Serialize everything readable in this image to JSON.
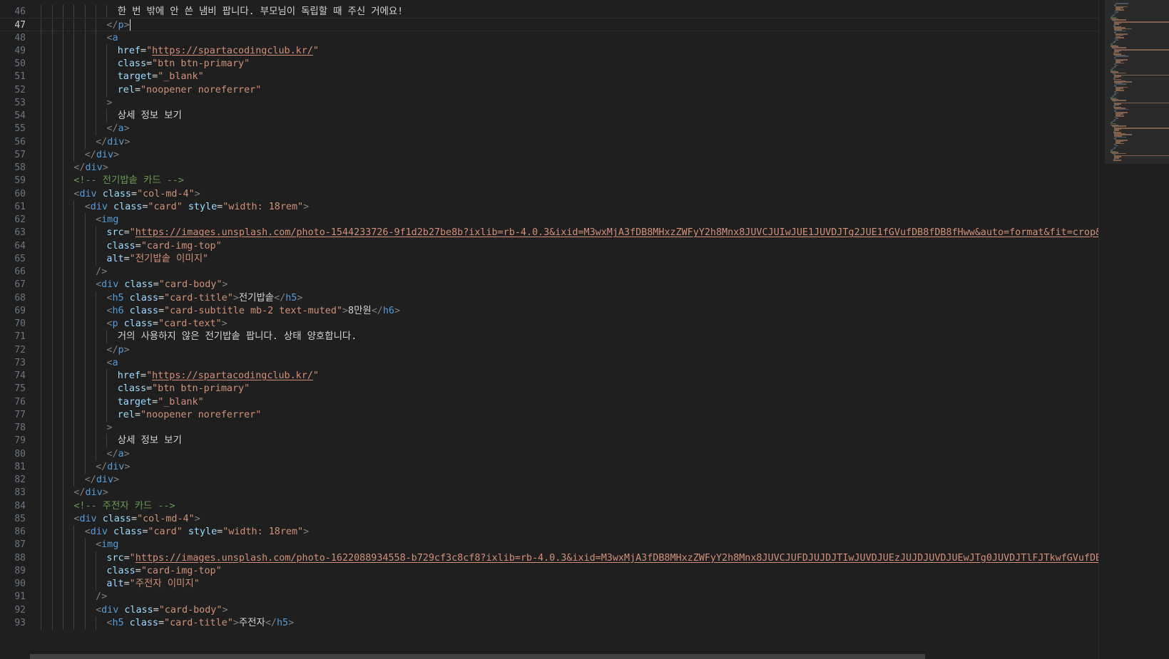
{
  "editor": {
    "language": "html",
    "current_line": 47,
    "colors": {
      "background": "#1f1f1f",
      "tag": "#569cd6",
      "attribute": "#9cdcfe",
      "string": "#ce9178",
      "comment": "#6a9955",
      "text": "#d4d4d4",
      "line_number": "#6e7681"
    },
    "lines": [
      {
        "n": "46",
        "indent": 8,
        "tokens": [
          [
            "t",
            "한 번 밖에 안 쓴 냄비 팝니다. 부모님이 독립할 때 주신 거에요!"
          ]
        ]
      },
      {
        "n": "47",
        "indent": 7,
        "tokens": [
          [
            "b",
            "</"
          ],
          [
            "g",
            "p"
          ],
          [
            "b",
            ">"
          ],
          [
            "cur",
            ""
          ]
        ]
      },
      {
        "n": "48",
        "indent": 7,
        "tokens": [
          [
            "b",
            "<"
          ],
          [
            "g",
            "a"
          ]
        ]
      },
      {
        "n": "49",
        "indent": 8,
        "tokens": [
          [
            "a",
            "href"
          ],
          [
            "e",
            "="
          ],
          [
            "s",
            "\""
          ],
          [
            "u",
            "https://spartacodingclub.kr/"
          ],
          [
            "s",
            "\""
          ]
        ]
      },
      {
        "n": "50",
        "indent": 8,
        "tokens": [
          [
            "a",
            "class"
          ],
          [
            "e",
            "="
          ],
          [
            "s",
            "\"btn btn-primary\""
          ]
        ]
      },
      {
        "n": "51",
        "indent": 8,
        "tokens": [
          [
            "a",
            "target"
          ],
          [
            "e",
            "="
          ],
          [
            "s",
            "\"_blank\""
          ]
        ]
      },
      {
        "n": "52",
        "indent": 8,
        "tokens": [
          [
            "a",
            "rel"
          ],
          [
            "e",
            "="
          ],
          [
            "s",
            "\"noopener noreferrer\""
          ]
        ]
      },
      {
        "n": "53",
        "indent": 7,
        "tokens": [
          [
            "b",
            ">"
          ]
        ]
      },
      {
        "n": "54",
        "indent": 8,
        "tokens": [
          [
            "t",
            "상세 정보 보기"
          ]
        ]
      },
      {
        "n": "55",
        "indent": 7,
        "tokens": [
          [
            "b",
            "</"
          ],
          [
            "g",
            "a"
          ],
          [
            "b",
            ">"
          ]
        ]
      },
      {
        "n": "56",
        "indent": 6,
        "tokens": [
          [
            "b",
            "</"
          ],
          [
            "g",
            "div"
          ],
          [
            "b",
            ">"
          ]
        ]
      },
      {
        "n": "57",
        "indent": 5,
        "tokens": [
          [
            "b",
            "</"
          ],
          [
            "g",
            "div"
          ],
          [
            "b",
            ">"
          ]
        ]
      },
      {
        "n": "58",
        "indent": 4,
        "tokens": [
          [
            "b",
            "</"
          ],
          [
            "g",
            "div"
          ],
          [
            "b",
            ">"
          ]
        ]
      },
      {
        "n": "59",
        "indent": 4,
        "tokens": [
          [
            "c",
            "<!-- 전기밥솥 카드 -->"
          ]
        ]
      },
      {
        "n": "60",
        "indent": 4,
        "tokens": [
          [
            "b",
            "<"
          ],
          [
            "g",
            "div"
          ],
          [
            "t",
            " "
          ],
          [
            "a",
            "class"
          ],
          [
            "e",
            "="
          ],
          [
            "s",
            "\"col-md-4\""
          ],
          [
            "b",
            ">"
          ]
        ]
      },
      {
        "n": "61",
        "indent": 5,
        "tokens": [
          [
            "b",
            "<"
          ],
          [
            "g",
            "div"
          ],
          [
            "t",
            " "
          ],
          [
            "a",
            "class"
          ],
          [
            "e",
            "="
          ],
          [
            "s",
            "\"card\""
          ],
          [
            "t",
            " "
          ],
          [
            "a",
            "style"
          ],
          [
            "e",
            "="
          ],
          [
            "s",
            "\"width: 18rem\""
          ],
          [
            "b",
            ">"
          ]
        ]
      },
      {
        "n": "62",
        "indent": 6,
        "tokens": [
          [
            "b",
            "<"
          ],
          [
            "g",
            "img"
          ]
        ]
      },
      {
        "n": "63",
        "indent": 7,
        "tokens": [
          [
            "a",
            "src"
          ],
          [
            "e",
            "="
          ],
          [
            "s",
            "\""
          ],
          [
            "u",
            "https://images.unsplash.com/photo-1544233726-9f1d2b27be8b?ixlib=rb-4.0.3&ixid=M3wxMjA3fDB8MHxzZWFyY2h8Mnx8JUVCJUIwJUE1JUVDJTg2JUE1fGVufDB8fDB8fHww&auto=format&fit=crop&w=500&q="
          ]
        ]
      },
      {
        "n": "64",
        "indent": 7,
        "tokens": [
          [
            "a",
            "class"
          ],
          [
            "e",
            "="
          ],
          [
            "s",
            "\"card-img-top\""
          ]
        ]
      },
      {
        "n": "65",
        "indent": 7,
        "tokens": [
          [
            "a",
            "alt"
          ],
          [
            "e",
            "="
          ],
          [
            "s",
            "\"전기밥솥 이미지\""
          ]
        ]
      },
      {
        "n": "66",
        "indent": 6,
        "tokens": [
          [
            "b",
            "/>"
          ]
        ]
      },
      {
        "n": "67",
        "indent": 6,
        "tokens": [
          [
            "b",
            "<"
          ],
          [
            "g",
            "div"
          ],
          [
            "t",
            " "
          ],
          [
            "a",
            "class"
          ],
          [
            "e",
            "="
          ],
          [
            "s",
            "\"card-body\""
          ],
          [
            "b",
            ">"
          ]
        ]
      },
      {
        "n": "68",
        "indent": 7,
        "tokens": [
          [
            "b",
            "<"
          ],
          [
            "g",
            "h5"
          ],
          [
            "t",
            " "
          ],
          [
            "a",
            "class"
          ],
          [
            "e",
            "="
          ],
          [
            "s",
            "\"card-title\""
          ],
          [
            "b",
            ">"
          ],
          [
            "t",
            "전기밥솥"
          ],
          [
            "b",
            "</"
          ],
          [
            "g",
            "h5"
          ],
          [
            "b",
            ">"
          ]
        ]
      },
      {
        "n": "69",
        "indent": 7,
        "tokens": [
          [
            "b",
            "<"
          ],
          [
            "g",
            "h6"
          ],
          [
            "t",
            " "
          ],
          [
            "a",
            "class"
          ],
          [
            "e",
            "="
          ],
          [
            "s",
            "\"card-subtitle mb-2 text-muted\""
          ],
          [
            "b",
            ">"
          ],
          [
            "t",
            "8만원"
          ],
          [
            "b",
            "</"
          ],
          [
            "g",
            "h6"
          ],
          [
            "b",
            ">"
          ]
        ]
      },
      {
        "n": "70",
        "indent": 7,
        "tokens": [
          [
            "b",
            "<"
          ],
          [
            "g",
            "p"
          ],
          [
            "t",
            " "
          ],
          [
            "a",
            "class"
          ],
          [
            "e",
            "="
          ],
          [
            "s",
            "\"card-text\""
          ],
          [
            "b",
            ">"
          ]
        ]
      },
      {
        "n": "71",
        "indent": 8,
        "tokens": [
          [
            "t",
            "거의 사용하지 않은 전기밥솥 팝니다. 상태 양호합니다."
          ]
        ]
      },
      {
        "n": "72",
        "indent": 7,
        "tokens": [
          [
            "b",
            "</"
          ],
          [
            "g",
            "p"
          ],
          [
            "b",
            ">"
          ]
        ]
      },
      {
        "n": "73",
        "indent": 7,
        "tokens": [
          [
            "b",
            "<"
          ],
          [
            "g",
            "a"
          ]
        ]
      },
      {
        "n": "74",
        "indent": 8,
        "tokens": [
          [
            "a",
            "href"
          ],
          [
            "e",
            "="
          ],
          [
            "s",
            "\""
          ],
          [
            "u",
            "https://spartacodingclub.kr/"
          ],
          [
            "s",
            "\""
          ]
        ]
      },
      {
        "n": "75",
        "indent": 8,
        "tokens": [
          [
            "a",
            "class"
          ],
          [
            "e",
            "="
          ],
          [
            "s",
            "\"btn btn-primary\""
          ]
        ]
      },
      {
        "n": "76",
        "indent": 8,
        "tokens": [
          [
            "a",
            "target"
          ],
          [
            "e",
            "="
          ],
          [
            "s",
            "\"_blank\""
          ]
        ]
      },
      {
        "n": "77",
        "indent": 8,
        "tokens": [
          [
            "a",
            "rel"
          ],
          [
            "e",
            "="
          ],
          [
            "s",
            "\"noopener noreferrer\""
          ]
        ]
      },
      {
        "n": "78",
        "indent": 7,
        "tokens": [
          [
            "b",
            ">"
          ]
        ]
      },
      {
        "n": "79",
        "indent": 8,
        "tokens": [
          [
            "t",
            "상세 정보 보기"
          ]
        ]
      },
      {
        "n": "80",
        "indent": 7,
        "tokens": [
          [
            "b",
            "</"
          ],
          [
            "g",
            "a"
          ],
          [
            "b",
            ">"
          ]
        ]
      },
      {
        "n": "81",
        "indent": 6,
        "tokens": [
          [
            "b",
            "</"
          ],
          [
            "g",
            "div"
          ],
          [
            "b",
            ">"
          ]
        ]
      },
      {
        "n": "82",
        "indent": 5,
        "tokens": [
          [
            "b",
            "</"
          ],
          [
            "g",
            "div"
          ],
          [
            "b",
            ">"
          ]
        ]
      },
      {
        "n": "83",
        "indent": 4,
        "tokens": [
          [
            "b",
            "</"
          ],
          [
            "g",
            "div"
          ],
          [
            "b",
            ">"
          ]
        ]
      },
      {
        "n": "84",
        "indent": 4,
        "tokens": [
          [
            "c",
            "<!-- 주전자 카드 -->"
          ]
        ]
      },
      {
        "n": "85",
        "indent": 4,
        "tokens": [
          [
            "b",
            "<"
          ],
          [
            "g",
            "div"
          ],
          [
            "t",
            " "
          ],
          [
            "a",
            "class"
          ],
          [
            "e",
            "="
          ],
          [
            "s",
            "\"col-md-4\""
          ],
          [
            "b",
            ">"
          ]
        ]
      },
      {
        "n": "86",
        "indent": 5,
        "tokens": [
          [
            "b",
            "<"
          ],
          [
            "g",
            "div"
          ],
          [
            "t",
            " "
          ],
          [
            "a",
            "class"
          ],
          [
            "e",
            "="
          ],
          [
            "s",
            "\"card\""
          ],
          [
            "t",
            " "
          ],
          [
            "a",
            "style"
          ],
          [
            "e",
            "="
          ],
          [
            "s",
            "\"width: 18rem\""
          ],
          [
            "b",
            ">"
          ]
        ]
      },
      {
        "n": "87",
        "indent": 6,
        "tokens": [
          [
            "b",
            "<"
          ],
          [
            "g",
            "img"
          ]
        ]
      },
      {
        "n": "88",
        "indent": 7,
        "tokens": [
          [
            "a",
            "src"
          ],
          [
            "e",
            "="
          ],
          [
            "s",
            "\""
          ],
          [
            "u",
            "https://images.unsplash.com/photo-1622088934558-b729cf3c8cf8?ixlib=rb-4.0.3&ixid=M3wxMjA3fDB8MHxzZWFyY2h8Mnx8JUVCJUFDJUJDJTIwJUVDJUEzJUJDJUVDJUEwJTg0JUVDJTlFJTkwfGVufDB8fDB8fHw"
          ]
        ]
      },
      {
        "n": "89",
        "indent": 7,
        "tokens": [
          [
            "a",
            "class"
          ],
          [
            "e",
            "="
          ],
          [
            "s",
            "\"card-img-top\""
          ]
        ]
      },
      {
        "n": "90",
        "indent": 7,
        "tokens": [
          [
            "a",
            "alt"
          ],
          [
            "e",
            "="
          ],
          [
            "s",
            "\"주전자 이미지\""
          ]
        ]
      },
      {
        "n": "91",
        "indent": 6,
        "tokens": [
          [
            "b",
            "/>"
          ]
        ]
      },
      {
        "n": "92",
        "indent": 6,
        "tokens": [
          [
            "b",
            "<"
          ],
          [
            "g",
            "div"
          ],
          [
            "t",
            " "
          ],
          [
            "a",
            "class"
          ],
          [
            "e",
            "="
          ],
          [
            "s",
            "\"card-body\""
          ],
          [
            "b",
            ">"
          ]
        ]
      },
      {
        "n": "93",
        "indent": 7,
        "tokens": [
          [
            "b",
            "<"
          ],
          [
            "g",
            "h5"
          ],
          [
            "t",
            " "
          ],
          [
            "a",
            "class"
          ],
          [
            "e",
            "="
          ],
          [
            "s",
            "\"card-title\""
          ],
          [
            "b",
            ">"
          ],
          [
            "t",
            "주전자"
          ],
          [
            "b",
            "</"
          ],
          [
            "g",
            "h5"
          ],
          [
            "b",
            ">"
          ]
        ]
      }
    ]
  }
}
